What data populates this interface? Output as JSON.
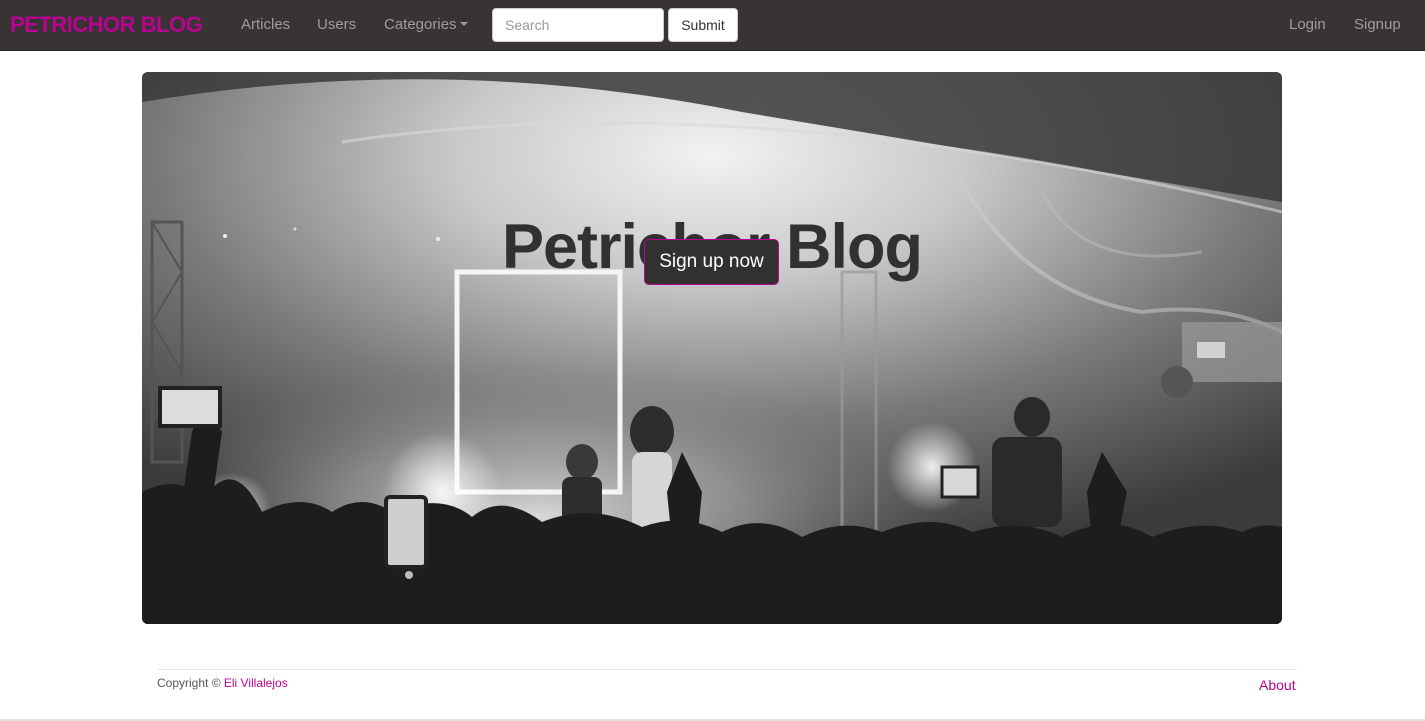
{
  "colors": {
    "brand": "#b8048e",
    "navbar_bg": "#383434",
    "nav_link": "#9d9d9d",
    "hero_text": "#333030"
  },
  "navbar": {
    "brand": "PETRICHOR BLOG",
    "links": {
      "articles": "Articles",
      "users": "Users",
      "categories": "Categories"
    },
    "search": {
      "placeholder": "Search",
      "value": ""
    },
    "submit_label": "Submit",
    "login": "Login",
    "signup": "Signup"
  },
  "hero": {
    "title": "Petrichor Blog",
    "cta_label": "Sign up now",
    "background": "concert-crowd-photo"
  },
  "footer": {
    "copyright_prefix": "Copyright ©",
    "author": "Eli Villalejos",
    "about": "About"
  }
}
